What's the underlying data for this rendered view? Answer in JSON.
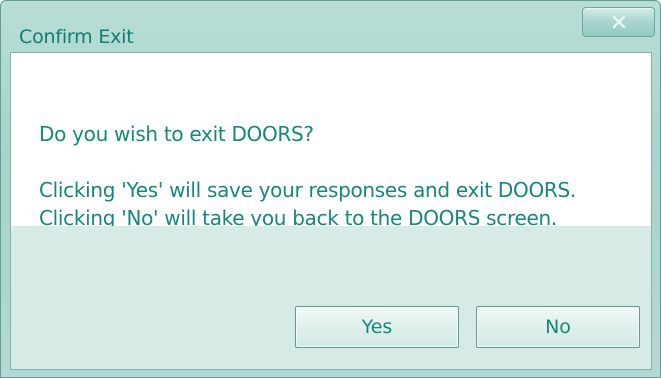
{
  "window": {
    "title": "Confirm Exit",
    "close_icon": "close-x-icon"
  },
  "message": {
    "question": "Do you wish to exit DOORS?",
    "line1": "Clicking 'Yes' will save your responses and exit DOORS.",
    "line2": "Clicking 'No' will take you back to the DOORS screen."
  },
  "buttons": {
    "yes_label": "Yes",
    "no_label": "No"
  },
  "colors": {
    "accent_text": "#16887b",
    "title_text": "#0f7f73",
    "frame": "#a6d3cb",
    "footer": "#d6eae6"
  }
}
